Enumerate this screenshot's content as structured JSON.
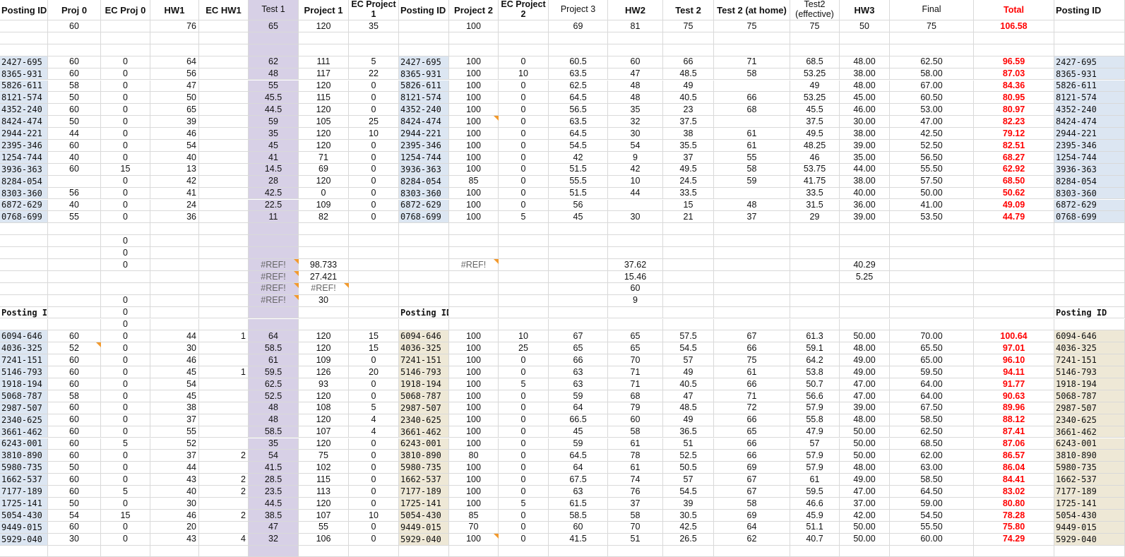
{
  "headers": [
    "Posting ID",
    "Proj 0",
    "EC Proj 0",
    "HW1",
    "EC HW1",
    "Test 1",
    "Project 1",
    "EC Project 1",
    "Posting ID",
    "Project 2",
    "EC Project 2",
    "Project 3",
    "HW2",
    "Test 2",
    "Test 2 (at home)",
    "Test2 (effective)",
    "HW3",
    "Final",
    "Total",
    "Posting ID"
  ],
  "max_row": [
    "",
    "60",
    "",
    "76",
    "",
    "65",
    "120",
    "35",
    "",
    "100",
    "",
    "69",
    "81",
    "75",
    "75",
    "75",
    "50",
    "75",
    "106.58",
    ""
  ],
  "section1_rows": [
    [
      "2427-695",
      "60",
      "0",
      "64",
      "",
      "62",
      "111",
      "5",
      "2427-695",
      "100",
      "0",
      "60.5",
      "60",
      "66",
      "71",
      "68.5",
      "48.00",
      "62.50",
      "96.59",
      "2427-695"
    ],
    [
      "8365-931",
      "60",
      "0",
      "56",
      "",
      "48",
      "117",
      "22",
      "8365-931",
      "100",
      "10",
      "63.5",
      "47",
      "48.5",
      "58",
      "53.25",
      "38.00",
      "58.00",
      "87.03",
      "8365-931"
    ],
    [
      "5826-611",
      "58",
      "0",
      "47",
      "",
      "55",
      "120",
      "0",
      "5826-611",
      "100",
      "0",
      "62.5",
      "48",
      "49",
      "",
      "49",
      "48.00",
      "67.00",
      "84.36",
      "5826-611"
    ],
    [
      "8121-574",
      "50",
      "0",
      "50",
      "",
      "45.5",
      "115",
      "0",
      "8121-574",
      "100",
      "0",
      "64.5",
      "48",
      "40.5",
      "66",
      "53.25",
      "45.00",
      "60.50",
      "80.95",
      "8121-574"
    ],
    [
      "4352-240",
      "60",
      "0",
      "65",
      "",
      "44.5",
      "120",
      "0",
      "4352-240",
      "100",
      "0",
      "56.5",
      "35",
      "23",
      "68",
      "45.5",
      "46.00",
      "53.00",
      "80.97",
      "4352-240"
    ],
    [
      "8424-474",
      "50",
      "0",
      "39",
      "",
      "59",
      "105",
      "25",
      "8424-474",
      "100",
      "0",
      "63.5",
      "32",
      "37.5",
      "",
      "37.5",
      "30.00",
      "47.00",
      "82.23",
      "8424-474"
    ],
    [
      "2944-221",
      "44",
      "0",
      "46",
      "",
      "35",
      "120",
      "10",
      "2944-221",
      "100",
      "0",
      "64.5",
      "30",
      "38",
      "61",
      "49.5",
      "38.00",
      "42.50",
      "79.12",
      "2944-221"
    ],
    [
      "2395-346",
      "60",
      "0",
      "54",
      "",
      "45",
      "120",
      "0",
      "2395-346",
      "100",
      "0",
      "54.5",
      "54",
      "35.5",
      "61",
      "48.25",
      "39.00",
      "52.50",
      "82.51",
      "2395-346"
    ],
    [
      "1254-744",
      "40",
      "0",
      "40",
      "",
      "41",
      "71",
      "0",
      "1254-744",
      "100",
      "0",
      "42",
      "9",
      "37",
      "55",
      "46",
      "35.00",
      "56.50",
      "68.27",
      "1254-744"
    ],
    [
      "3936-363",
      "60",
      "15",
      "13",
      "",
      "14.5",
      "69",
      "0",
      "3936-363",
      "100",
      "0",
      "51.5",
      "42",
      "49.5",
      "58",
      "53.75",
      "44.00",
      "55.50",
      "62.92",
      "3936-363"
    ],
    [
      "8284-054",
      "",
      "0",
      "42",
      "",
      "28",
      "120",
      "0",
      "8284-054",
      "85",
      "0",
      "55.5",
      "10",
      "24.5",
      "59",
      "41.75",
      "38.00",
      "57.50",
      "68.50",
      "8284-054"
    ],
    [
      "8303-360",
      "56",
      "0",
      "41",
      "",
      "42.5",
      "0",
      "0",
      "8303-360",
      "100",
      "0",
      "51.5",
      "44",
      "33.5",
      "",
      "33.5",
      "40.00",
      "50.00",
      "50.62",
      "8303-360"
    ],
    [
      "6872-629",
      "40",
      "0",
      "24",
      "",
      "22.5",
      "109",
      "0",
      "6872-629",
      "100",
      "0",
      "56",
      "",
      "15",
      "48",
      "31.5",
      "36.00",
      "41.00",
      "49.09",
      "6872-629"
    ],
    [
      "0768-699",
      "55",
      "0",
      "36",
      "",
      "11",
      "82",
      "0",
      "0768-699",
      "100",
      "5",
      "45",
      "30",
      "21",
      "37",
      "29",
      "39.00",
      "53.50",
      "44.79",
      "0768-699"
    ]
  ],
  "middle_rows": [
    [
      "",
      "",
      "",
      "",
      "",
      "",
      "",
      "",
      "",
      "",
      "",
      "",
      "",
      "",
      "",
      "",
      "",
      "",
      "",
      ""
    ],
    [
      "",
      "",
      "0",
      "",
      "",
      "",
      "",
      "",
      "",
      "",
      "",
      "",
      "",
      "",
      "",
      "",
      "",
      "",
      "",
      ""
    ],
    [
      "",
      "",
      "0",
      "",
      "",
      "",
      "",
      "",
      "",
      "",
      "",
      "",
      "",
      "",
      "",
      "",
      "",
      "",
      "",
      ""
    ],
    [
      "",
      "",
      "0",
      "",
      "",
      "#REF!",
      "98.733",
      "",
      "",
      "#REF!",
      "",
      "",
      "37.62",
      "",
      "",
      "",
      "40.29",
      "",
      "",
      ""
    ],
    [
      "",
      "",
      "",
      "",
      "",
      "#REF!",
      "27.421",
      "",
      "",
      "",
      "",
      "",
      "15.46",
      "",
      "",
      "",
      "5.25",
      "",
      "",
      ""
    ],
    [
      "",
      "",
      "",
      "",
      "",
      "#REF!",
      "#REF!",
      "",
      "",
      "",
      "",
      "",
      "60",
      "",
      "",
      "",
      "",
      "",
      "",
      ""
    ],
    [
      "",
      "",
      "0",
      "",
      "",
      "#REF!",
      "30",
      "",
      "",
      "",
      "",
      "",
      "9",
      "",
      "",
      "",
      "",
      "",
      "",
      ""
    ],
    [
      "Posting ID",
      "",
      "0",
      "",
      "",
      "",
      "",
      "",
      "Posting ID",
      "",
      "",
      "",
      "",
      "",
      "",
      "",
      "",
      "",
      "",
      "Posting ID"
    ],
    [
      "",
      "",
      "0",
      "",
      "",
      "",
      "",
      "",
      "",
      "",
      "",
      "",
      "",
      "",
      "",
      "",
      "",
      "",
      "",
      ""
    ]
  ],
  "section2_rows": [
    [
      "6094-646",
      "60",
      "0",
      "44",
      "1",
      "64",
      "120",
      "15",
      "6094-646",
      "100",
      "10",
      "67",
      "65",
      "57.5",
      "67",
      "61.3",
      "50.00",
      "70.00",
      "100.64",
      "6094-646"
    ],
    [
      "4036-325",
      "52",
      "0",
      "30",
      "",
      "58.5",
      "120",
      "15",
      "4036-325",
      "100",
      "25",
      "65",
      "65",
      "54.5",
      "66",
      "59.1",
      "48.00",
      "65.50",
      "97.01",
      "4036-325"
    ],
    [
      "7241-151",
      "60",
      "0",
      "46",
      "",
      "61",
      "109",
      "0",
      "7241-151",
      "100",
      "0",
      "66",
      "70",
      "57",
      "75",
      "64.2",
      "49.00",
      "65.00",
      "96.10",
      "7241-151"
    ],
    [
      "5146-793",
      "60",
      "0",
      "45",
      "1",
      "59.5",
      "126",
      "20",
      "5146-793",
      "100",
      "0",
      "63",
      "71",
      "49",
      "61",
      "53.8",
      "49.00",
      "59.50",
      "94.11",
      "5146-793"
    ],
    [
      "1918-194",
      "60",
      "0",
      "54",
      "",
      "62.5",
      "93",
      "0",
      "1918-194",
      "100",
      "5",
      "63",
      "71",
      "40.5",
      "66",
      "50.7",
      "47.00",
      "64.00",
      "91.77",
      "1918-194"
    ],
    [
      "5068-787",
      "58",
      "0",
      "45",
      "",
      "52.5",
      "120",
      "0",
      "5068-787",
      "100",
      "0",
      "59",
      "68",
      "47",
      "71",
      "56.6",
      "47.00",
      "64.00",
      "90.63",
      "5068-787"
    ],
    [
      "2987-507",
      "60",
      "0",
      "38",
      "",
      "48",
      "108",
      "5",
      "2987-507",
      "100",
      "0",
      "64",
      "79",
      "48.5",
      "72",
      "57.9",
      "39.00",
      "67.50",
      "89.96",
      "2987-507"
    ],
    [
      "2340-625",
      "60",
      "0",
      "37",
      "",
      "48",
      "120",
      "4",
      "2340-625",
      "100",
      "0",
      "66.5",
      "60",
      "49",
      "66",
      "55.8",
      "48.00",
      "58.50",
      "88.12",
      "2340-625"
    ],
    [
      "3661-462",
      "60",
      "0",
      "55",
      "",
      "58.5",
      "107",
      "4",
      "3661-462",
      "100",
      "0",
      "45",
      "58",
      "36.5",
      "65",
      "47.9",
      "50.00",
      "62.50",
      "87.41",
      "3661-462"
    ],
    [
      "6243-001",
      "60",
      "5",
      "52",
      "",
      "35",
      "120",
      "0",
      "6243-001",
      "100",
      "0",
      "59",
      "61",
      "51",
      "66",
      "57",
      "50.00",
      "68.50",
      "87.06",
      "6243-001"
    ],
    [
      "3810-890",
      "60",
      "0",
      "37",
      "2",
      "54",
      "75",
      "0",
      "3810-890",
      "80",
      "0",
      "64.5",
      "78",
      "52.5",
      "66",
      "57.9",
      "50.00",
      "62.00",
      "86.57",
      "3810-890"
    ],
    [
      "5980-735",
      "50",
      "0",
      "44",
      "",
      "41.5",
      "102",
      "0",
      "5980-735",
      "100",
      "0",
      "64",
      "61",
      "50.5",
      "69",
      "57.9",
      "48.00",
      "63.00",
      "86.04",
      "5980-735"
    ],
    [
      "1662-537",
      "60",
      "0",
      "43",
      "2",
      "28.5",
      "115",
      "0",
      "1662-537",
      "100",
      "0",
      "67.5",
      "74",
      "57",
      "67",
      "61",
      "49.00",
      "58.50",
      "84.41",
      "1662-537"
    ],
    [
      "7177-189",
      "60",
      "5",
      "40",
      "2",
      "23.5",
      "113",
      "0",
      "7177-189",
      "100",
      "0",
      "63",
      "76",
      "54.5",
      "67",
      "59.5",
      "47.00",
      "64.50",
      "83.02",
      "7177-189"
    ],
    [
      "1725-141",
      "50",
      "0",
      "30",
      "",
      "44.5",
      "120",
      "0",
      "1725-141",
      "100",
      "5",
      "61.5",
      "37",
      "39",
      "58",
      "46.6",
      "37.00",
      "59.00",
      "80.80",
      "1725-141"
    ],
    [
      "5054-430",
      "54",
      "15",
      "46",
      "2",
      "38.5",
      "107",
      "10",
      "5054-430",
      "85",
      "0",
      "58.5",
      "58",
      "30.5",
      "69",
      "45.9",
      "42.00",
      "54.50",
      "78.28",
      "5054-430"
    ],
    [
      "9449-015",
      "60",
      "0",
      "20",
      "",
      "47",
      "55",
      "0",
      "9449-015",
      "70",
      "0",
      "60",
      "70",
      "42.5",
      "64",
      "51.1",
      "50.00",
      "55.50",
      "75.80",
      "9449-015"
    ],
    [
      "5929-040",
      "30",
      "0",
      "43",
      "4",
      "32",
      "106",
      "0",
      "5929-040",
      "100",
      "0",
      "41.5",
      "51",
      "26.5",
      "62",
      "40.7",
      "50.00",
      "60.00",
      "74.29",
      "5929-040"
    ]
  ],
  "colors": {
    "total": "#ff0000",
    "id_blue": "#dce6f2",
    "id_tan": "#eee8d6",
    "test1_col": "#d7d0e6",
    "comment_marker": "#f29a2e"
  }
}
